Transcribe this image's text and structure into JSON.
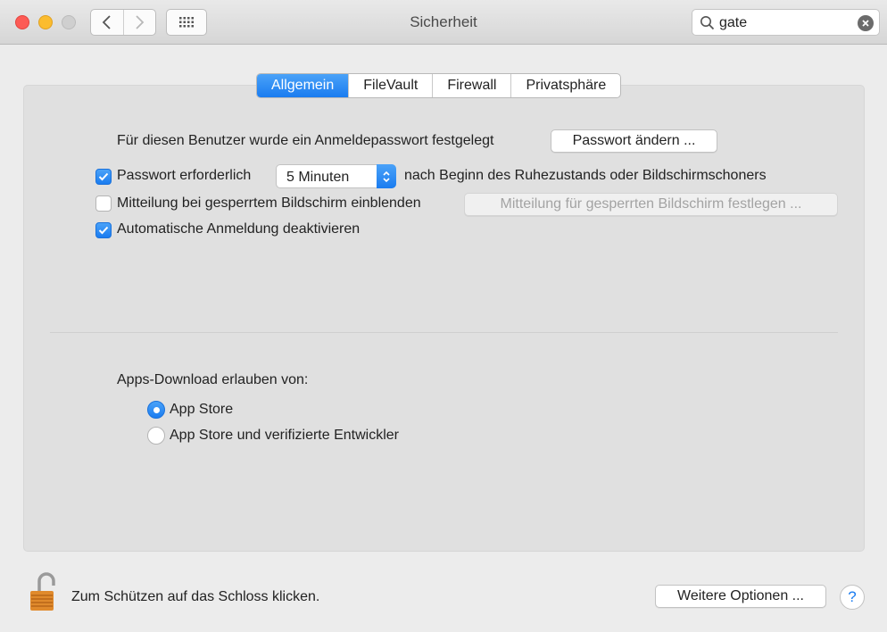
{
  "window": {
    "title": "Sicherheit"
  },
  "search": {
    "value": "gate"
  },
  "tabs": [
    {
      "label": "Allgemein",
      "active": true
    },
    {
      "label": "FileVault",
      "active": false
    },
    {
      "label": "Firewall",
      "active": false
    },
    {
      "label": "Privatsphäre",
      "active": false
    }
  ],
  "general": {
    "password_set_text": "Für diesen Benutzer wurde ein Anmeldepasswort festgelegt",
    "change_password_button": "Passwort ändern ...",
    "require_password": {
      "label": "Passwort erforderlich",
      "checked": true
    },
    "delay_select": {
      "value": "5 Minuten"
    },
    "after_text": "nach Beginn des Ruhezustands oder Bildschirmschoners",
    "show_message": {
      "label": "Mitteilung bei gesperrtem Bildschirm einblenden",
      "checked": false
    },
    "set_message_button": "Mitteilung für gesperrten Bildschirm festlegen ...",
    "disable_autologin": {
      "label": "Automatische Anmeldung deaktivieren",
      "checked": true
    }
  },
  "apps_download": {
    "heading": "Apps-Download erlauben von:",
    "options": [
      {
        "label": "App Store",
        "selected": true
      },
      {
        "label": "App Store und verifizierte Entwickler",
        "selected": false
      }
    ]
  },
  "footer": {
    "lock_text": "Zum Schützen auf das Schloss klicken.",
    "more_options_button": "Weitere Optionen ...",
    "help_label": "?"
  },
  "colors": {
    "accent": "#1a7cf0",
    "close": "#fd5b55",
    "minimize": "#fbbc2e",
    "lock_gold": "#e08a2c"
  }
}
